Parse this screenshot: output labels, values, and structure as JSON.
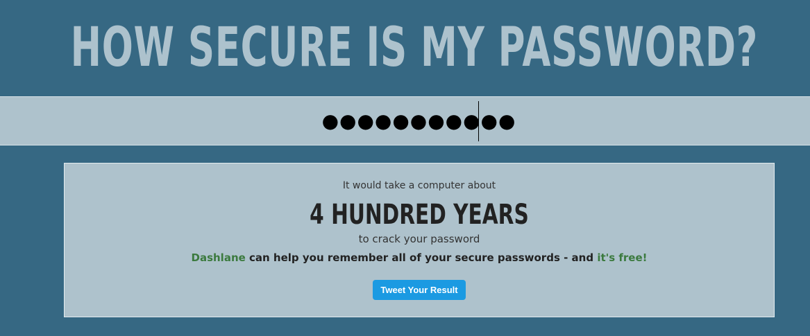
{
  "header": {
    "title": "HOW SECURE IS MY PASSWORD?"
  },
  "password": {
    "value": "●●●●●●●●●●●"
  },
  "result": {
    "pre_text": "It would take a computer about",
    "time": "4 HUNDRED YEARS",
    "post_text": "to crack your password",
    "promo": {
      "brand_link": "Dashlane",
      "text": " can help you remember all of your secure passwords - and ",
      "free_link": "it's free!"
    },
    "tweet_button": "Tweet Your Result"
  },
  "colors": {
    "background": "#366883",
    "panel": "#aec2cc",
    "title": "#adc2cd",
    "link_green": "#3b7a3e",
    "button_blue": "#1b9ae2"
  }
}
